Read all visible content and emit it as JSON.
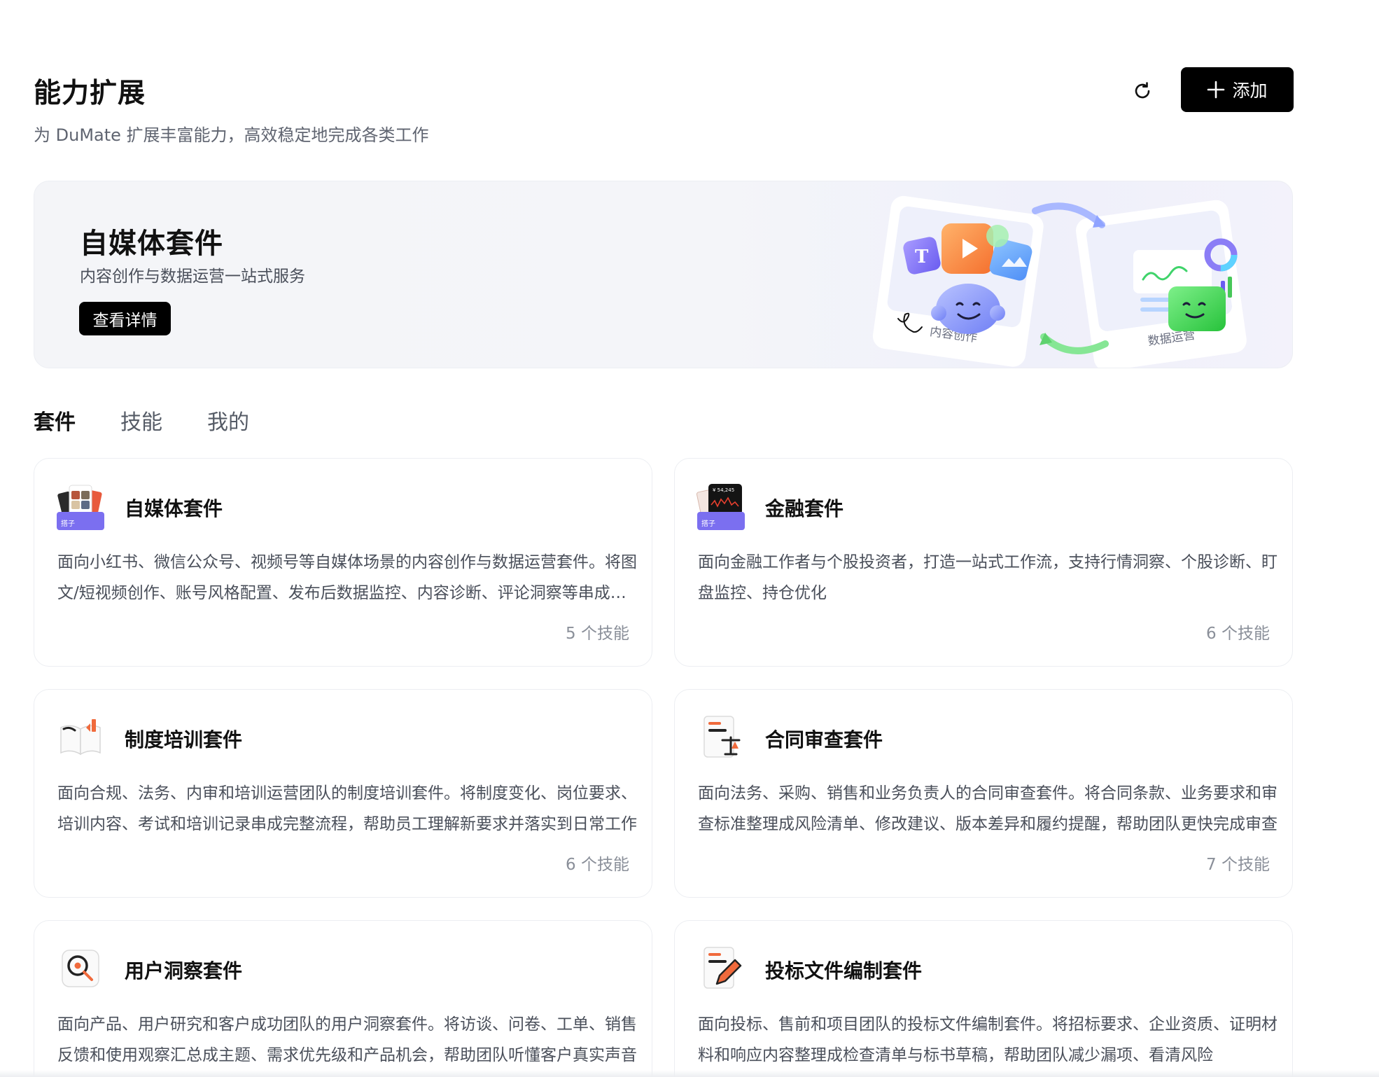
{
  "header": {
    "title": "能力扩展",
    "subtitle": "为 DuMate 扩展丰富能力，高效稳定地完成各类工作",
    "refresh_icon": "refresh-icon",
    "add_label": "添加",
    "add_icon": "plus-icon"
  },
  "banner": {
    "title": "自媒体套件",
    "subtitle": "内容创作与数据运营一站式服务",
    "button_label": "查看详情",
    "art_label_left": "内容创作",
    "art_label_right": "数据运营"
  },
  "tabs": [
    {
      "label": "套件",
      "active": true
    },
    {
      "label": "技能",
      "active": false
    },
    {
      "label": "我的",
      "active": false
    }
  ],
  "cards": [
    {
      "title": "自媒体套件",
      "description": "面向小红书、微信公众号、视频号等自媒体场景的内容创作与数据运营套件。将图文/短视频创作、账号风格配置、发布后数据监控、内容诊断、评论洞察等串成完整流程",
      "count": "5 个技能",
      "icon": "media-kit-icon",
      "icon_badge": "搭子"
    },
    {
      "title": "金融套件",
      "description": "面向金融工作者与个股投资者，打造一站式工作流，支持行情洞察、个股诊断、盯盘监控、持仓优化",
      "count": "6 个技能",
      "icon": "finance-kit-icon",
      "icon_badge": "搭子",
      "icon_text": "¥ 54,245"
    },
    {
      "title": "制度培训套件",
      "description": "面向合规、法务、内审和培训运营团队的制度培训套件。将制度变化、岗位要求、培训内容、考试和培训记录串成完整流程，帮助员工理解新要求并落实到日常工作",
      "count": "6 个技能",
      "icon": "book-icon"
    },
    {
      "title": "合同审查套件",
      "description": "面向法务、采购、销售和业务负责人的合同审查套件。将合同条款、业务要求和审查标准整理成风险清单、修改建议、版本差异和履约提醒，帮助团队更快完成审查",
      "count": "7 个技能",
      "icon": "contract-scale-icon"
    },
    {
      "title": "用户洞察套件",
      "description": "面向产品、用户研究和客户成功团队的用户洞察套件。将访谈、问卷、工单、销售反馈和使用观察汇总成主题、需求优先级和产品机会，帮助团队听懂客户真实声音",
      "count": "",
      "icon": "magnifier-icon"
    },
    {
      "title": "投标文件编制套件",
      "description": "面向投标、售前和项目团队的投标文件编制套件。将招标要求、企业资质、证明材料和响应内容整理成检查清单与标书草稿，帮助团队减少漏项、看清风险",
      "count": "",
      "icon": "document-pen-icon"
    }
  ],
  "colors": {
    "primary_button": "#000000",
    "badge_purple": "#7b6ff0",
    "accent_orange": "#f06a3c",
    "text_secondary": "#5f6470"
  }
}
